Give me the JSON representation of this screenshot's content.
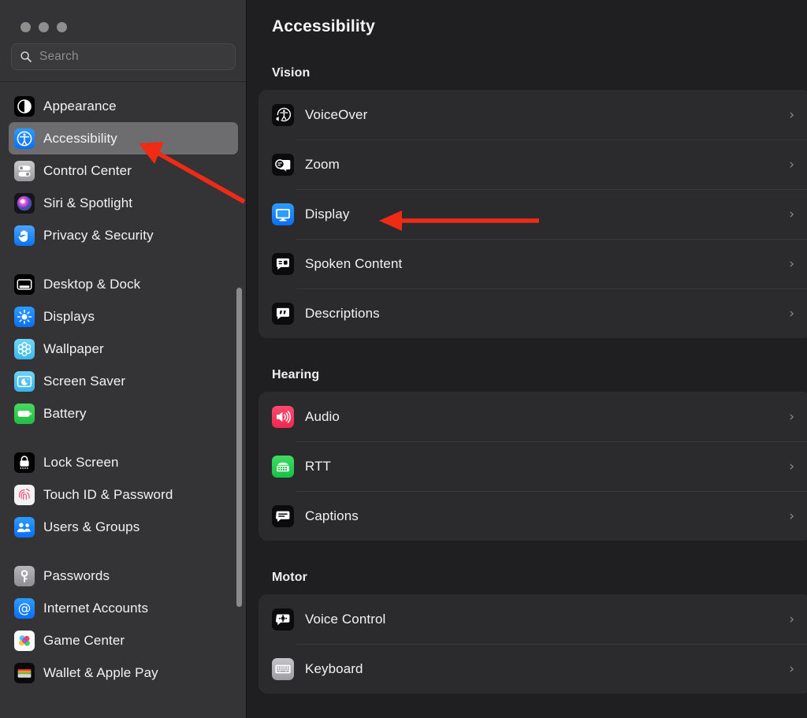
{
  "window": {
    "traffic_lights": [
      "close",
      "minimize",
      "zoom"
    ],
    "search": {
      "placeholder": "Search",
      "value": "",
      "icon": "search-icon"
    }
  },
  "sidebar": {
    "groups": [
      {
        "items": [
          {
            "label": "Appearance",
            "icon": "appearance-icon",
            "selected": false
          },
          {
            "label": "Accessibility",
            "icon": "accessibility-icon",
            "selected": true
          },
          {
            "label": "Control Center",
            "icon": "control-center-icon",
            "selected": false
          },
          {
            "label": "Siri & Spotlight",
            "icon": "siri-icon",
            "selected": false
          },
          {
            "label": "Privacy & Security",
            "icon": "privacy-security-icon",
            "selected": false
          }
        ]
      },
      {
        "items": [
          {
            "label": "Desktop & Dock",
            "icon": "desktop-dock-icon",
            "selected": false
          },
          {
            "label": "Displays",
            "icon": "displays-icon",
            "selected": false
          },
          {
            "label": "Wallpaper",
            "icon": "wallpaper-icon",
            "selected": false
          },
          {
            "label": "Screen Saver",
            "icon": "screen-saver-icon",
            "selected": false
          },
          {
            "label": "Battery",
            "icon": "battery-icon",
            "selected": false
          }
        ]
      },
      {
        "items": [
          {
            "label": "Lock Screen",
            "icon": "lock-screen-icon",
            "selected": false
          },
          {
            "label": "Touch ID & Password",
            "icon": "touch-id-icon",
            "selected": false
          },
          {
            "label": "Users & Groups",
            "icon": "users-groups-icon",
            "selected": false
          }
        ]
      },
      {
        "items": [
          {
            "label": "Passwords",
            "icon": "passwords-icon",
            "selected": false
          },
          {
            "label": "Internet Accounts",
            "icon": "internet-accounts-icon",
            "selected": false
          },
          {
            "label": "Game Center",
            "icon": "game-center-icon",
            "selected": false
          },
          {
            "label": "Wallet & Apple Pay",
            "icon": "wallet-apple-pay-icon",
            "selected": false
          }
        ]
      }
    ]
  },
  "main": {
    "title": "Accessibility",
    "sections": [
      {
        "heading": "Vision",
        "rows": [
          {
            "label": "VoiceOver",
            "icon": "voiceover-icon",
            "chevron": "›"
          },
          {
            "label": "Zoom",
            "icon": "zoom-icon",
            "chevron": "›"
          },
          {
            "label": "Display",
            "icon": "display-icon",
            "chevron": "›"
          },
          {
            "label": "Spoken Content",
            "icon": "spoken-content-icon",
            "chevron": "›"
          },
          {
            "label": "Descriptions",
            "icon": "descriptions-icon",
            "chevron": "›"
          }
        ]
      },
      {
        "heading": "Hearing",
        "rows": [
          {
            "label": "Audio",
            "icon": "audio-icon",
            "chevron": "›"
          },
          {
            "label": "RTT",
            "icon": "rtt-icon",
            "chevron": "›"
          },
          {
            "label": "Captions",
            "icon": "captions-icon",
            "chevron": "›"
          }
        ]
      },
      {
        "heading": "Motor",
        "rows": [
          {
            "label": "Voice Control",
            "icon": "voice-control-icon",
            "chevron": "›"
          },
          {
            "label": "Keyboard",
            "icon": "keyboard-icon",
            "chevron": "›"
          }
        ]
      }
    ]
  },
  "annotations": {
    "color": "#ef2b16",
    "arrows": [
      {
        "name": "arrow-to-accessibility",
        "points_to": "Accessibility"
      },
      {
        "name": "arrow-to-display",
        "points_to": "Display"
      }
    ]
  },
  "colors": {
    "sidebar_bg": "#343436",
    "content_bg": "#1f1f21",
    "card_bg": "#2b2b2d",
    "selection": "#6d6d70",
    "accent_blue": "#007aff",
    "annotation_red": "#ef2b16"
  }
}
